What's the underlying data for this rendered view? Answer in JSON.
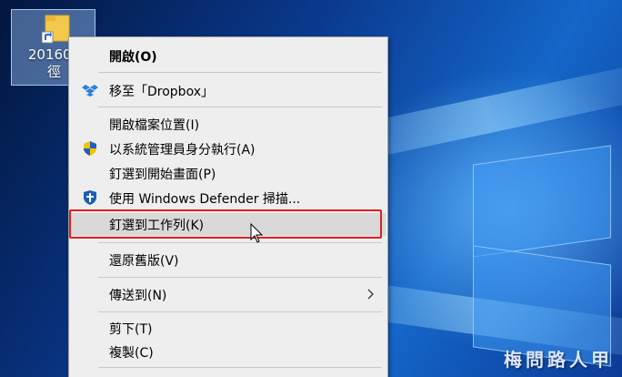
{
  "desktop": {
    "icon_label": "201609\n徑",
    "watermark": "梅問路人甲"
  },
  "menu": {
    "items": [
      {
        "label": "開啟(O)",
        "icon": ""
      },
      {
        "label": "移至「Dropbox」",
        "icon": "dropbox-icon"
      },
      {
        "label": "開啟檔案位置(I)",
        "icon": ""
      },
      {
        "label": "以系統管理員身分執行(A)",
        "icon": "uac-shield-icon"
      },
      {
        "label": "釘選到開始畫面(P)",
        "icon": ""
      },
      {
        "label": "使用 Windows Defender 掃描...",
        "icon": "defender-icon"
      },
      {
        "label": "釘選到工作列(K)",
        "icon": "",
        "highlighted": true
      },
      {
        "label": "還原舊版(V)",
        "icon": ""
      },
      {
        "label": "傳送到(N)",
        "icon": "",
        "submenu": true
      },
      {
        "label": "剪下(T)",
        "icon": ""
      },
      {
        "label": "複製(C)",
        "icon": ""
      }
    ]
  }
}
